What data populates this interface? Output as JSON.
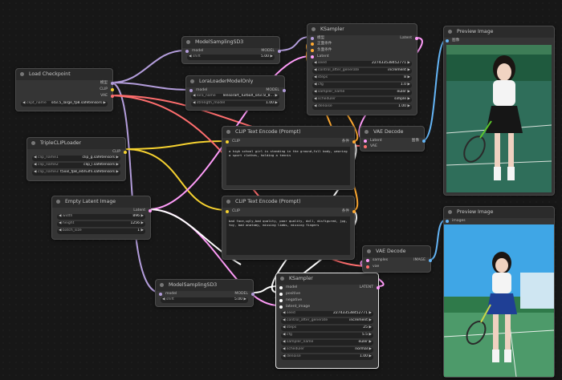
{
  "colors": {
    "model": "#b39ddb",
    "clip": "#f5d130",
    "vae": "#ff6e6e",
    "latent": "#ff9cf9",
    "conditioning": "#ffa931",
    "image": "#64b5f6",
    "background": "#171717",
    "node": "#353535",
    "title": "#2b2b2b"
  },
  "nodes": {
    "load_checkpoint": {
      "title": "Load Checkpoint",
      "out1": "模型",
      "out2": "CLIP",
      "out3": "VAE",
      "w1_label": "ckpt_name",
      "w1_value": "sd3.5_large_fp8.safetensors"
    },
    "model_sampling_top": {
      "title": "ModelSamplingSD3",
      "in1": "model",
      "out1": "MODEL",
      "w1_label": "shift",
      "w1_value": "5.00"
    },
    "lora": {
      "title": "LoraLoaderModelOnly",
      "in1": "model",
      "out1": "MODEL",
      "w1_label": "lora_name",
      "w1_value": "Tensorart_TurboX_sd3.5l_8…",
      "w2_label": "strength_model",
      "w2_value": "1.00"
    },
    "triple_clip": {
      "title": "TripleCLIPLoader",
      "out1": "CLIP",
      "w1_label": "clip_name1",
      "w1_value": "clip_g.safetensors",
      "w2_label": "clip_name2",
      "w2_value": "clip_l.safetensors",
      "w3_label": "clip_name3",
      "w3_value": "t5xxl_fp8_e4m3fn.safetensors"
    },
    "clip_pos": {
      "title": "CLIP Text Encode (Prompt)",
      "in1": "CLIP",
      "out1": "条件",
      "text": "a high school girl is standing in the ground,full body, wearing a sport clothes, holding a tennis"
    },
    "clip_neg": {
      "title": "CLIP Text Encode (Prompt)",
      "in1": "CLIP",
      "out1": "条件",
      "text": "bad face,ugly,bad quality, poor quality, doll, disfigured, jpg, toy, bad anatomy, missing limbs, missing fingers"
    },
    "empty_latent": {
      "title": "Empty Latent Image",
      "out1": "Latent",
      "w1_label": "width",
      "w1_value": "896",
      "w2_label": "height",
      "w2_value": "1256",
      "w3_label": "batch_size",
      "w3_value": "1"
    },
    "ksampler_top": {
      "title": "KSampler",
      "in1": "模型",
      "in2": "正面条件",
      "in3": "负面条件",
      "in4": "Latent",
      "out1": "Latent",
      "w1_label": "seed",
      "w1_value": "227433538452771",
      "w2_label": "control_after_generate",
      "w2_value": "increment",
      "w3_label": "steps",
      "w3_value": "8",
      "w4_label": "cfg",
      "w4_value": "1.0",
      "w5_label": "sampler_name",
      "w5_value": "euler",
      "w6_label": "scheduler",
      "w6_value": "simple",
      "w7_label": "denoise",
      "w7_value": "1.00"
    },
    "vae_decode_top": {
      "title": "VAE Decode",
      "in1": "Latent",
      "in2": "VAE",
      "out1": "图像"
    },
    "preview_top": {
      "title": "Preview Image",
      "in1": "图像"
    },
    "model_sampling_bottom": {
      "title": "ModelSamplingSD3",
      "in1": "model",
      "out1": "MODEL",
      "w1_label": "shift",
      "w1_value": "5.00"
    },
    "ksampler_bottom": {
      "title": "KSampler",
      "in1": "model",
      "in2": "positive",
      "in3": "negative",
      "in4": "latent_image",
      "out1": "LATENT",
      "w1_label": "seed",
      "w1_value": "227433538452771",
      "w2_label": "control_after_generate",
      "w2_value": "increment",
      "w3_label": "steps",
      "w3_value": "25",
      "w4_label": "cfg",
      "w4_value": "5.5",
      "w5_label": "sampler_name",
      "w5_value": "euler",
      "w6_label": "scheduler",
      "w6_value": "normal",
      "w7_label": "denoise",
      "w7_value": "1.00"
    },
    "vae_decode_bottom": {
      "title": "VAE Decode",
      "in1": "samples",
      "in2": "vae",
      "out1": "IMAGE"
    },
    "preview_bottom": {
      "title": "Preview Image",
      "in1": "images"
    }
  }
}
